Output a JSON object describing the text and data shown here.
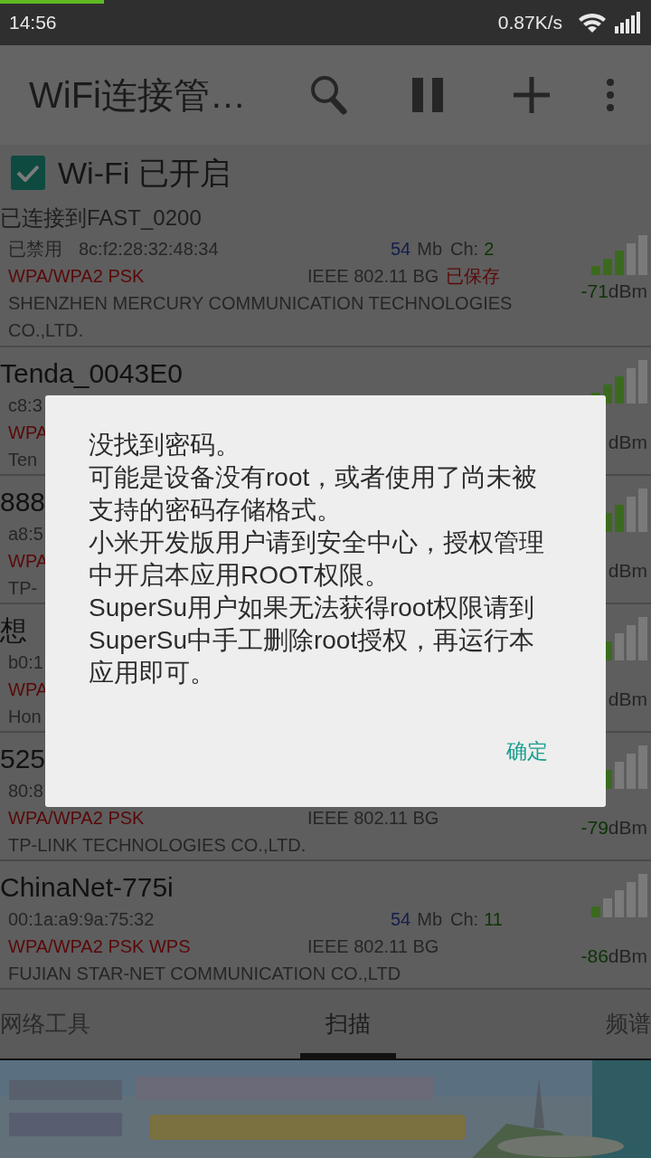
{
  "status_bar": {
    "time": "14:56",
    "speed": "0.87K/s",
    "progress": {
      "level": 0.16
    }
  },
  "app_bar": {
    "title": "WiFi连接管…"
  },
  "wifi_toggle": {
    "label": "Wi-Fi 已开启",
    "checked": true
  },
  "connection": "已连接到FAST_0200",
  "networks": [
    {
      "status": "已禁用",
      "mac": "8c:f2:28:32:48:34",
      "speed": "54",
      "speed_unit": "Mb",
      "channel_label": "Ch:",
      "channel": "2",
      "security": "WPA/WPA2 PSK",
      "standard": "IEEE 802.11 BG",
      "saved": "已保存",
      "vendor": "SHENZHEN MERCURY COMMUNICATION TECHNOLOGIES CO.,LTD.",
      "signal": {
        "level": 0.6
      },
      "rssi": "-71",
      "rssi_unit": "dBm"
    },
    {
      "name": "Tenda_0043E0",
      "mac": "c8:3",
      "security": "WPA",
      "vendor": "Ten",
      "signal": {
        "level": 0.6
      },
      "rssi_unit": "dBm"
    },
    {
      "name": "888",
      "mac": "a8:5",
      "security": "WPA",
      "vendor": "TP-",
      "signal": {
        "level": 0.6
      },
      "rssi_unit": "dBm"
    },
    {
      "name": "想",
      "mac": "b0:1",
      "security": "WPA",
      "vendor": "Hon",
      "signal": {
        "level": 0.4
      },
      "rssi_unit": "dBm"
    },
    {
      "name": "525",
      "mac": "80:8",
      "security": "WPA/WPA2 PSK",
      "standard": "IEEE 802.11 BG",
      "vendor": "TP-LINK TECHNOLOGIES CO.,LTD.",
      "signal": {
        "level": 0.4
      },
      "rssi": "-79",
      "rssi_unit": "dBm"
    },
    {
      "name": "ChinaNet-775i",
      "mac": "00:1a:a9:9a:75:32",
      "speed": "54",
      "speed_unit": "Mb",
      "channel_label": "Ch:",
      "channel": "11",
      "security": "WPA/WPA2 PSK WPS",
      "standard": "IEEE 802.11 BG",
      "vendor": "FUJIAN STAR-NET COMMUNICATION CO.,LTD",
      "signal": {
        "level": 0.2
      },
      "rssi": "-86",
      "rssi_unit": "dBm"
    }
  ],
  "tabs": [
    {
      "label": "网络工具",
      "selected": false
    },
    {
      "label": "扫描",
      "selected": true
    },
    {
      "label": "频谱",
      "selected": false
    }
  ],
  "dialog": {
    "paragraphs": [
      "没找到密码。",
      "可能是设备没有root，或者使用了尚未被支持的密码存储格式。",
      "小米开发版用户请到安全中心，授权管理中开启本应用ROOT权限。",
      "SuperSu用户如果无法获得root权限请到SuperSu中手工删除root授权，再运行本应用即可。"
    ],
    "button": "确定"
  }
}
